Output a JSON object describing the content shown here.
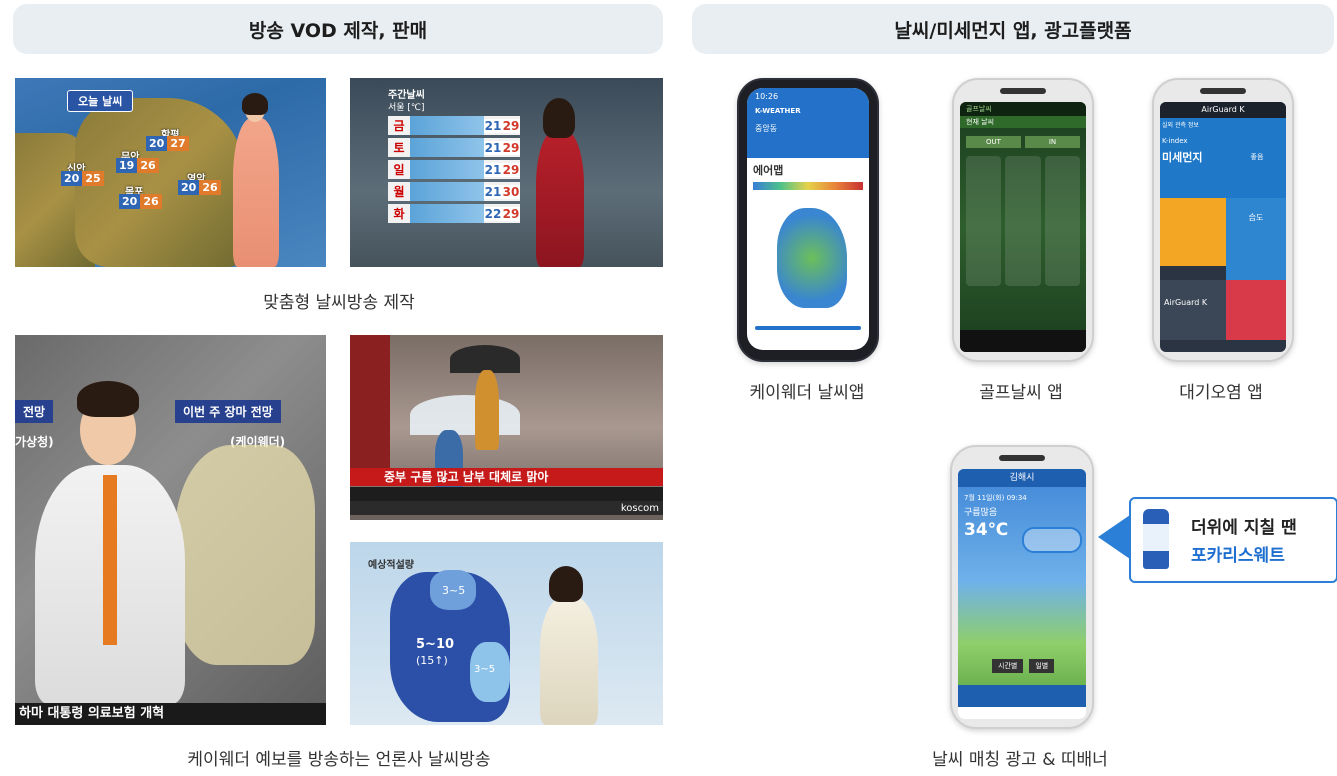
{
  "left_header": "방송 VOD 제작, 판매",
  "right_header": "날씨/미세먼지 앱, 광고플랫폼",
  "captions": {
    "custom_broadcast": "맞춤형 날씨방송 제작",
    "press_broadcast": "케이웨더 예보를 방송하는 언론사 날씨방송",
    "kweather_app": "케이웨더 날씨앱",
    "golf_app": "골프날씨 앱",
    "air_app": "대기오염 앱",
    "ad_banner": "날씨 매칭 광고 & 띠배너"
  },
  "today_map": {
    "title": "오늘 날씨",
    "cities": [
      {
        "name": "신안",
        "lo": "20",
        "hi": "25"
      },
      {
        "name": "무안",
        "lo": "19",
        "hi": "26"
      },
      {
        "name": "함평",
        "lo": "20",
        "hi": "27"
      },
      {
        "name": "목포",
        "lo": "20",
        "hi": "26"
      },
      {
        "name": "영암",
        "lo": "20",
        "hi": "26"
      }
    ]
  },
  "weekly_map": {
    "title": "주간날씨",
    "subtitle": "서울 [℃]",
    "rows": [
      {
        "day": "금",
        "lo": "21",
        "hi": "29"
      },
      {
        "day": "토",
        "lo": "21",
        "hi": "29"
      },
      {
        "day": "일",
        "lo": "21",
        "hi": "29"
      },
      {
        "day": "월",
        "lo": "21",
        "hi": "30"
      },
      {
        "day": "화",
        "lo": "22",
        "hi": "29"
      }
    ]
  },
  "anchor_panel": {
    "left_tag": "전망",
    "right_tag": "이번 주 장마 전망",
    "sub_left": "가상청)",
    "sub_right": "(케이웨더)",
    "bottom": "하마 대통령 의료보험 개혁"
  },
  "rain_panel": {
    "headline": "중부 구름 많고 남부 대체로 맑아",
    "brand": "koscom"
  },
  "forecast_panel": {
    "title": "예상적설량",
    "r1": "3~5",
    "r2": "5~10",
    "r3": "(15↑)",
    "r4": "3~5"
  },
  "kweather_phone": {
    "time": "10:26",
    "brand": "K-WEATHER",
    "region": "중앙동",
    "card_title": "에어맵"
  },
  "golf_phone": {
    "brand": "골프날씨",
    "tab1": "현재 날씨",
    "tab2": "OUT",
    "tab3": "IN"
  },
  "air_phone": {
    "brand": "AirGuard K",
    "label1": "실외 관측 정보",
    "label2": "K-index",
    "big": "미세먼지",
    "good": "좋음",
    "sub1": "습도",
    "brand2": "AirGuard K"
  },
  "ad_phone": {
    "city": "김해시",
    "date": "7월 11일(화) 09:34",
    "cond": "구름많음",
    "temp": "34℃",
    "btn1": "시간별",
    "btn2": "일별"
  },
  "ad_bubble": {
    "line1": "더위에 지칠 땐",
    "line2": "포카리스웨트"
  }
}
